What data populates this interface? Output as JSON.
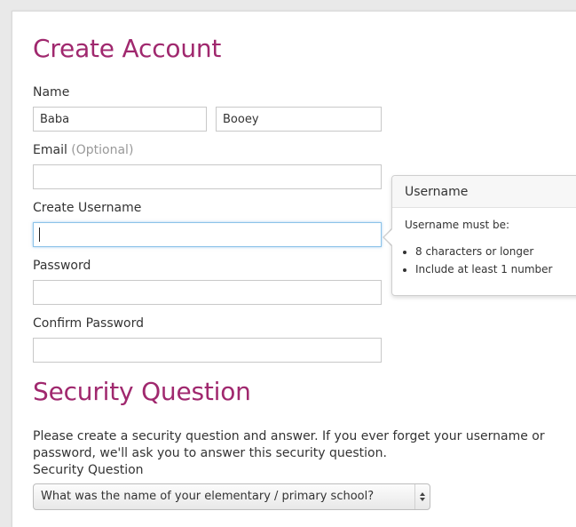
{
  "create_account": {
    "title": "Create Account",
    "name_label": "Name",
    "first_name_value": "Baba",
    "last_name_value": "Booey",
    "email_label": "Email",
    "email_optional": "(Optional)",
    "email_value": "",
    "username_label": "Create Username",
    "username_value": "",
    "password_label": "Password",
    "password_value": "",
    "confirm_password_label": "Confirm Password",
    "confirm_password_value": ""
  },
  "username_tooltip": {
    "header": "Username",
    "intro": "Username must be:",
    "rules": [
      "8 characters or longer",
      "Include at least 1 number"
    ]
  },
  "security": {
    "title": "Security Question",
    "description": "Please create a security question and answer. If you ever forget your username or password, we'll ask you to answer this security question.",
    "question_label": "Security Question",
    "question_selected": "What was the name of your elementary / primary school?"
  },
  "colors": {
    "heading": "#a0286e",
    "focus_border": "#8cc3e9"
  }
}
